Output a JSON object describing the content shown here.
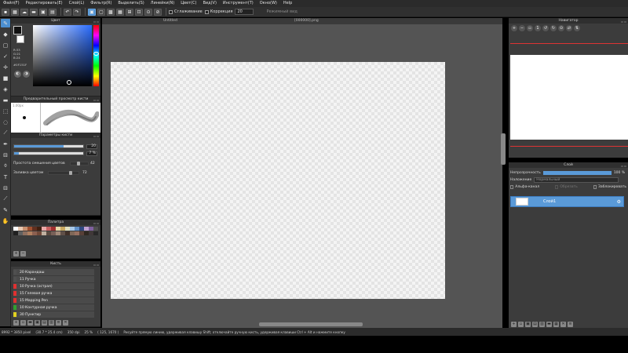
{
  "menu": [
    "Файл(F)",
    "Редактировать(E)",
    "Слой(L)",
    "Фильтр(R)",
    "Выделить(S)",
    "Линейки(N)",
    "Цвет(C)",
    "Вид(V)",
    "Инструмент(T)",
    "Окно(W)",
    "Help"
  ],
  "toolbar": {
    "smooth_label": "Сглаживание",
    "correction_label": "Коррекция",
    "correction_value": "20",
    "mode_text": "Режимный вид"
  },
  "color_panel": {
    "title": "Цвет",
    "r": "R:33",
    "g": "G:21",
    "b": "B:24",
    "hex": "#0F151F"
  },
  "preview_panel": {
    "title": "Предварительный просмотр кисти",
    "size_text": "1.00px"
  },
  "brush_panel": {
    "title": "Параметры кисти",
    "size_value": "20",
    "opacity_value": "7 %",
    "mix_label": "Простота смешения цветов",
    "mix_value": "42",
    "fill_label": "Заливка цветом",
    "fill_value": "72"
  },
  "palette_panel": {
    "title": "Палитра",
    "colors": [
      "#ffffff",
      "#e8c8b0",
      "#c89070",
      "#a05030",
      "#603020",
      "#402010",
      "#e8a8a8",
      "#c86060",
      "#a03030",
      "#e8d8a8",
      "#c8a860",
      "#e0e0c0",
      "#a8c8e8",
      "#6090c8",
      "#304880",
      "#c0a0d0",
      "#8060a0",
      "#505050"
    ],
    "colors2": [
      "#202020",
      "#606060",
      "#907060",
      "#b08060",
      "#8c6050",
      "#704838",
      "#c0b0a0",
      "#5a4a40",
      "#786058",
      "#a08878",
      "#605048",
      "#403028",
      "#806858",
      "#987060",
      "#584038",
      "#302820",
      "#403838",
      "#282828"
    ]
  },
  "brushes_panel": {
    "title": "Кисть",
    "items": [
      {
        "num": "20",
        "name": "Карандаш",
        "color": "#505050"
      },
      {
        "num": "11",
        "name": "Ручка",
        "color": "#505050"
      },
      {
        "num": "10",
        "name": "Ручка (острая)",
        "color": "#e03030"
      },
      {
        "num": "15",
        "name": "Гелевая ручка",
        "color": "#e03030"
      },
      {
        "num": "15",
        "name": "Mapping Pen",
        "color": "#e03030"
      },
      {
        "num": "10",
        "name": "Контурная ручка",
        "color": "#30a030"
      },
      {
        "num": "30",
        "name": "Пунктир",
        "color": "#e0d020"
      }
    ]
  },
  "doc_tabs": [
    "Untitled",
    "[000000].png"
  ],
  "navigator": {
    "title": "Навигатор"
  },
  "layer_panel": {
    "title": "Слой",
    "opacity_label": "Непрозрачность",
    "opacity_value": "100 %",
    "blend_label": "Наложение",
    "blend_value": "Нормальный",
    "alpha_label": "Альфа-канал",
    "clip_label": "Обрезать",
    "lock_label": "Заблокировать",
    "layer_name": "Слой1"
  },
  "status": {
    "size": "8992 * 3850 pixel",
    "cm": "(30.7 * 25.4 cm)",
    "dpi": "350 dpi",
    "zoom": "25 %",
    "coords": "( 125, 1670 )",
    "hint": "Рисуйте прямую линию, удерживая клавишу Shift; отключайте ручную кисть, удерживая клавиши Ctrl + Alt и нажмите кнопку"
  }
}
